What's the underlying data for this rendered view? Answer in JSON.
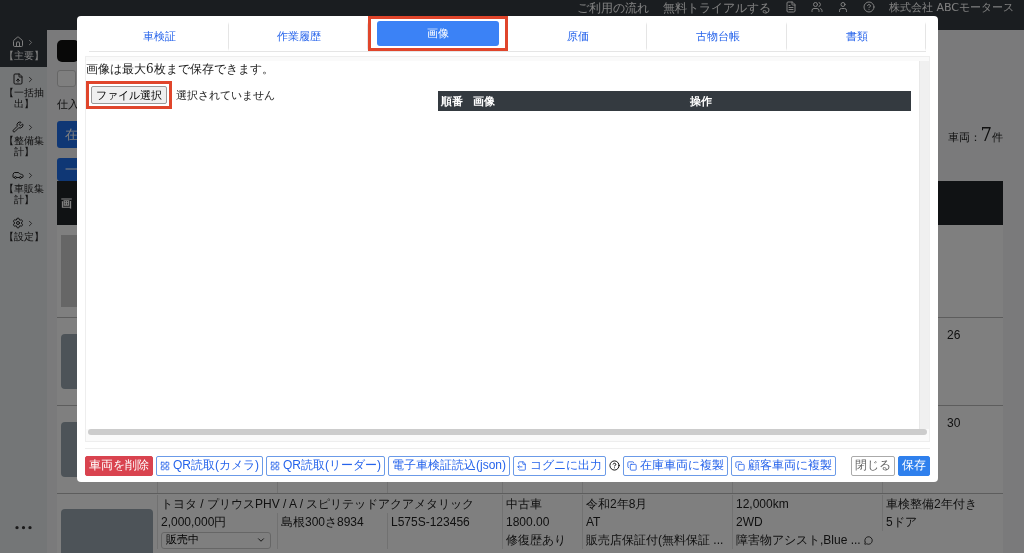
{
  "topbar": {
    "links": [
      "ご利用の流れ",
      "無料トライアルする"
    ],
    "company": "株式会社 ABCモータース"
  },
  "sidebar": {
    "items": [
      {
        "label": "【主要】",
        "selected": true
      },
      {
        "label": "【一括抽出】",
        "selected": false
      },
      {
        "label": "【整備集計】",
        "selected": false
      },
      {
        "label": "【車販集計】",
        "selected": false
      },
      {
        "label": "【設定】",
        "selected": false
      }
    ],
    "more": "•••"
  },
  "page": {
    "purchase_label": "仕入",
    "stock_button": "在",
    "bulk_button": "一",
    "vehicle_count": {
      "label": "車両：",
      "number": "7",
      "unit": "件"
    },
    "table_header": "画",
    "rows": [
      {
        "kind": "placeholder"
      },
      {
        "kind": "photo",
        "column_8": "26"
      },
      {
        "kind": "photo",
        "column_8": "30"
      },
      {
        "kind": "listing",
        "title": "トヨタ / プリウスPHV / A / スピリテッドアクアメタリック",
        "category": "中古車",
        "first_registration": "令和2年8月",
        "mileage": "12,000km",
        "inspection": "車検整備2年付き",
        "price": "2,000,000円",
        "plate": "島根300さ8934",
        "frame": "L575S-123456",
        "displacement": "1800.00",
        "transmission": "AT",
        "drive": "2WD",
        "doors": "5ドア",
        "status": "販売中",
        "history": "修復歴あり",
        "warranty": "販売店保証付(無料保証 ...",
        "equipment": "障害物アシスト,Blue ..."
      }
    ]
  },
  "modal": {
    "tabs": [
      {
        "label": "車検証",
        "selected": false,
        "highlighted": false
      },
      {
        "label": "作業履歴",
        "selected": false,
        "highlighted": false
      },
      {
        "label": "画像",
        "selected": true,
        "highlighted": true
      },
      {
        "label": "原価",
        "selected": false,
        "highlighted": false
      },
      {
        "label": "古物台帳",
        "selected": false,
        "highlighted": false
      },
      {
        "label": "書類",
        "selected": false,
        "highlighted": false
      }
    ],
    "note": "画像は最大6枚まで保存できます。",
    "file_button": {
      "label": "ファイル選択",
      "highlighted": true
    },
    "file_status": "選択されていません",
    "columns": [
      "順番",
      "画像",
      "操作"
    ],
    "footer_left": [
      {
        "kind": "danger",
        "label": "車両を削除"
      },
      {
        "kind": "grid",
        "label": "QR読取(カメラ)"
      },
      {
        "kind": "grid",
        "label": "QR読取(リーダー)"
      },
      {
        "kind": "outline",
        "label": "電子車検証読込(json)"
      },
      {
        "kind": "export",
        "label": "コグニに出力"
      },
      {
        "kind": "help"
      },
      {
        "kind": "copy",
        "label": "在庫車両に複製"
      },
      {
        "kind": "copy",
        "label": "顧客車両に複製"
      }
    ],
    "footer_right": [
      {
        "kind": "secondary",
        "label": "閉じる"
      },
      {
        "kind": "primary",
        "label": "保存"
      }
    ]
  }
}
